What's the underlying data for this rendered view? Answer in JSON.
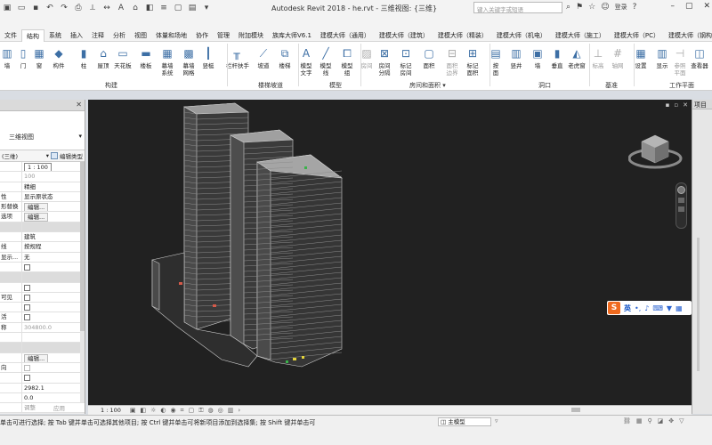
{
  "app": {
    "title": "Autodesk Revit 2018 -",
    "file": "he.rvt - 三维视图: {三维}",
    "search_placeholder": "键入关键字或短语",
    "login": "登录"
  },
  "menu": {
    "tabs": [
      "文件",
      "结构",
      "系统",
      "插入",
      "注释",
      "分析",
      "视图",
      "体量和场地",
      "协作",
      "管理",
      "附加模块",
      "族库大师V6.1",
      "建模大师（通用）",
      "建模大师（建筑）",
      "建模大师（精装）",
      "建模大师（机电）",
      "建模大师（施工）",
      "建模大师（PC）",
      "建模大师（钢构）"
    ]
  },
  "ribbon": {
    "tools": [
      {
        "label": "墙",
        "icon": "wall-icon"
      },
      {
        "label": "门",
        "icon": "door-icon"
      },
      {
        "label": "窗",
        "icon": "window-icon"
      },
      {
        "label": "构件",
        "icon": "component-icon"
      },
      {
        "label": "柱",
        "icon": "column-icon"
      },
      {
        "label": "屋顶",
        "icon": "roof-icon"
      },
      {
        "label": "天花板",
        "icon": "ceiling-icon"
      },
      {
        "label": "楼板",
        "icon": "floor-icon"
      },
      {
        "label": "幕墙\n系统",
        "icon": "curtain-system-icon"
      },
      {
        "label": "幕墙\n网格",
        "icon": "curtain-grid-icon"
      },
      {
        "label": "竖梃",
        "icon": "mullion-icon"
      },
      {
        "label": "栏杆扶手",
        "icon": "railing-icon"
      },
      {
        "label": "坡道",
        "icon": "ramp-icon"
      },
      {
        "label": "楼梯",
        "icon": "stair-icon"
      },
      {
        "label": "模型\n文字",
        "icon": "model-text-icon"
      },
      {
        "label": "模型\n线",
        "icon": "model-line-icon"
      },
      {
        "label": "模型\n组",
        "icon": "model-group-icon"
      },
      {
        "label": "房间",
        "icon": "room-icon"
      },
      {
        "label": "房间\n分隔",
        "icon": "room-separator-icon"
      },
      {
        "label": "标记\n房间",
        "icon": "tag-room-icon"
      },
      {
        "label": "面积",
        "icon": "area-icon"
      },
      {
        "label": "面积\n边界",
        "icon": "area-boundary-icon"
      },
      {
        "label": "标记\n面积",
        "icon": "tag-area-icon"
      },
      {
        "label": "按\n面",
        "icon": "by-face-icon"
      },
      {
        "label": "竖井",
        "icon": "shaft-icon"
      },
      {
        "label": "墙",
        "icon": "wall-opening-icon"
      },
      {
        "label": "垂直",
        "icon": "vertical-opening-icon"
      },
      {
        "label": "老虎窗",
        "icon": "dormer-icon"
      },
      {
        "label": "标高",
        "icon": "level-icon"
      },
      {
        "label": "轴网",
        "icon": "grid-icon"
      },
      {
        "label": "设置",
        "icon": "set-workplane-icon"
      },
      {
        "label": "显示",
        "icon": "show-workplane-icon"
      },
      {
        "label": "参照\n平面",
        "icon": "ref-plane-icon"
      },
      {
        "label": "查看器",
        "icon": "viewer-icon"
      }
    ],
    "groups": [
      "构建",
      "楼梯坡道",
      "模型",
      "房间和面积 ▾",
      "洞口",
      "基准",
      "工作平面"
    ]
  },
  "properties": {
    "type_name": "三维视图",
    "view_selector": "(三维)",
    "edit_type": "编辑类型",
    "rows": [
      {
        "k": "",
        "v": "1 : 100",
        "style": "box"
      },
      {
        "k": "",
        "v": "100",
        "style": "grey"
      },
      {
        "k": "",
        "v": "精细",
        "style": ""
      },
      {
        "k": "性",
        "v": "显示原状态",
        "style": ""
      },
      {
        "k": "形替换",
        "v": "编辑...",
        "style": "btn"
      },
      {
        "k": "选项",
        "v": "编辑...",
        "style": "btn"
      },
      {
        "k": "",
        "v": "",
        "style": "group"
      },
      {
        "k": "",
        "v": "建筑",
        "style": ""
      },
      {
        "k": "线",
        "v": "按规程",
        "style": ""
      },
      {
        "k": "显示...",
        "v": "无",
        "style": ""
      },
      {
        "k": "",
        "v": "",
        "style": "cb"
      },
      {
        "k": "",
        "v": "",
        "style": "group"
      },
      {
        "k": "",
        "v": "",
        "style": "cb"
      },
      {
        "k": "可见",
        "v": "",
        "style": "cb"
      },
      {
        "k": "",
        "v": "",
        "style": "cb"
      },
      {
        "k": "活",
        "v": "",
        "style": "cb"
      },
      {
        "k": "称",
        "v": "304800.0",
        "style": "grey"
      },
      {
        "k": "",
        "v": "",
        "style": "empty"
      },
      {
        "k": "",
        "v": "",
        "style": "group"
      },
      {
        "k": "",
        "v": "编辑...",
        "style": "btn"
      },
      {
        "k": "向",
        "v": "",
        "style": "cbgrey"
      },
      {
        "k": "",
        "v": "",
        "style": "cb"
      },
      {
        "k": "",
        "v": "2982.1",
        "style": ""
      },
      {
        "k": "",
        "v": "0.0",
        "style": ""
      },
      {
        "k": "",
        "v": "调整",
        "style": "grey"
      }
    ],
    "apply": "应用"
  },
  "viewport": {
    "scale": "1 : 100",
    "ime": {
      "letter": "S",
      "mode": "英"
    }
  },
  "right_panel": {
    "title": "项目"
  },
  "status": {
    "text": "单击可进行选择; 按 Tab 键并单击可选择其他项目; 按 Ctrl 键并单击可将新项目添加到选择集; 按 Shift 键并单击可",
    "model": "主模型"
  },
  "colors": {
    "accent": "#3d6fa5",
    "viewport_bg": "#212121",
    "building": "#c7c7c7"
  }
}
